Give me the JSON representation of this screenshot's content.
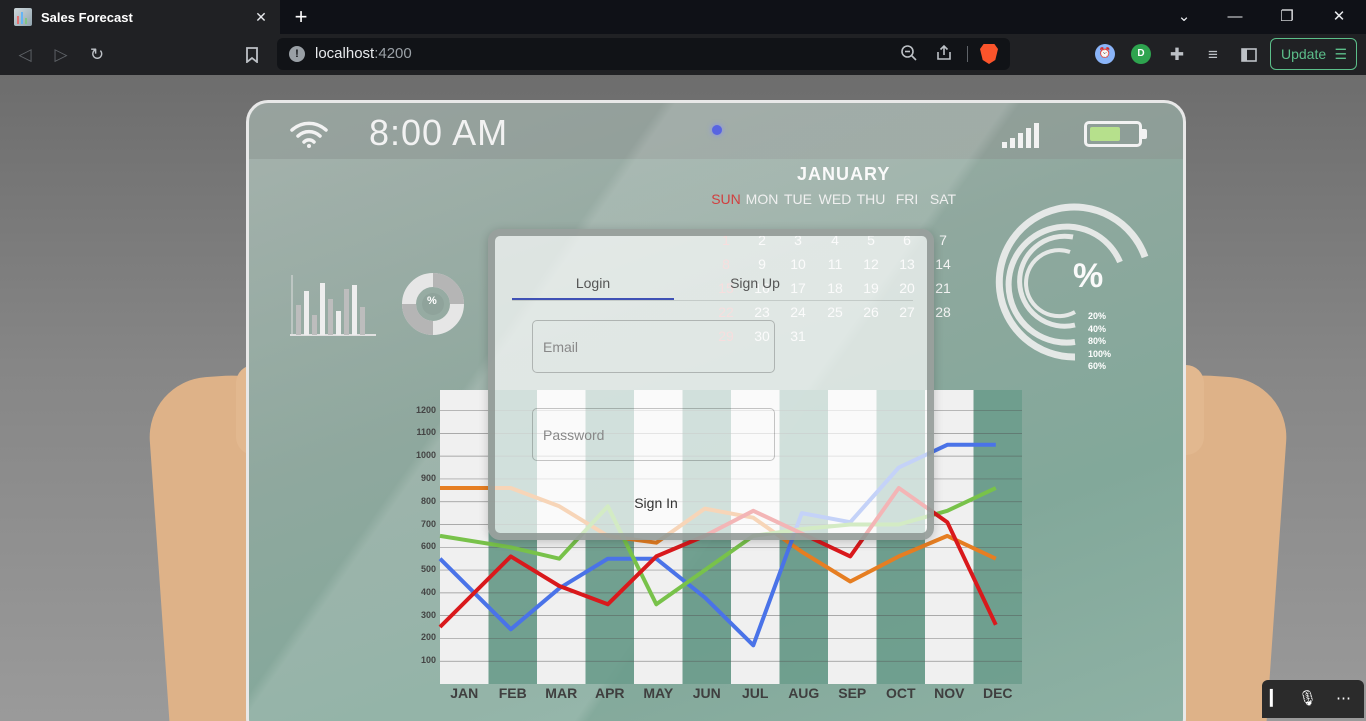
{
  "browser": {
    "tab_title": "Sales Forecast",
    "tab_close": "✕",
    "new_tab": "+",
    "url_host": "localhost",
    "url_port": ":4200",
    "update_label": "Update",
    "update_menu": "☰"
  },
  "tablet": {
    "time": "8:00 AM",
    "calendar": {
      "month": "JANUARY",
      "days_of_week": [
        "SUN",
        "MON",
        "TUE",
        "WED",
        "THU",
        "FRI",
        "SAT"
      ],
      "days": [
        [
          "1",
          "2",
          "3",
          "4",
          "5",
          "6",
          "7"
        ],
        [
          "8",
          "9",
          "10",
          "11",
          "12",
          "13",
          "14"
        ],
        [
          "15",
          "16",
          "17",
          "18",
          "19",
          "20",
          "21"
        ],
        [
          "22",
          "23",
          "24",
          "25",
          "26",
          "27",
          "28"
        ],
        [
          "29",
          "30",
          "31"
        ]
      ]
    },
    "ring_chart": {
      "symbol": "%",
      "labels": [
        "20%",
        "40%",
        "80%",
        "100%",
        "60%"
      ]
    },
    "mini_donut_symbol": "%"
  },
  "chart_data": {
    "type": "line",
    "categories": [
      "JAN",
      "FEB",
      "MAR",
      "APR",
      "MAY",
      "JUN",
      "JUL",
      "AUG",
      "SEP",
      "OCT",
      "NOV",
      "DEC"
    ],
    "y_ticks": [
      100,
      200,
      300,
      400,
      500,
      600,
      700,
      800,
      900,
      1000,
      1100,
      1200
    ],
    "ylim": [
      0,
      1200
    ],
    "grid": true,
    "series": [
      {
        "color": "#e67e22",
        "values": [
          860,
          860,
          780,
          650,
          620,
          770,
          730,
          580,
          450,
          560,
          650,
          550
        ]
      },
      {
        "color": "#4a73e8",
        "values": [
          550,
          240,
          420,
          550,
          550,
          380,
          170,
          750,
          710,
          950,
          1050,
          1050
        ]
      },
      {
        "color": "#78c24a",
        "values": [
          650,
          600,
          550,
          780,
          350,
          500,
          650,
          680,
          700,
          700,
          760,
          860
        ]
      },
      {
        "color": "#d9191c",
        "values": [
          250,
          560,
          430,
          350,
          560,
          650,
          760,
          660,
          560,
          860,
          710,
          260
        ]
      }
    ]
  },
  "login": {
    "tab_login": "Login",
    "tab_signup": "Sign Up",
    "email_placeholder": "Email",
    "password_placeholder": "Password",
    "signin_label": "Sign In"
  }
}
